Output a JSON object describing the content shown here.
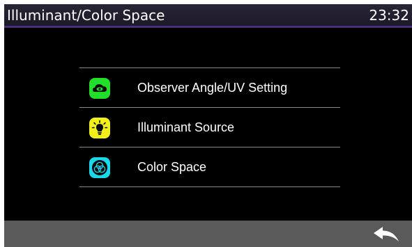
{
  "header": {
    "title": "Illuminant/Color Space",
    "time": "23:32"
  },
  "menu": {
    "items": [
      {
        "label": "Observer Angle/UV Setting",
        "icon": "eye-cloud-icon",
        "color": "#22e02a"
      },
      {
        "label": "Illuminant Source",
        "icon": "lightbulb-icon",
        "color": "#f2ef1a"
      },
      {
        "label": "Color Space",
        "icon": "color-circles-icon",
        "color": "#1ad8ea"
      }
    ]
  },
  "footer": {
    "back_icon": "back-arrow-icon"
  },
  "colors": {
    "background": "#000000",
    "titlebar_accent": "#4a2f7a",
    "footer": "#5a5a5a",
    "divider": "#8a8a8a"
  }
}
